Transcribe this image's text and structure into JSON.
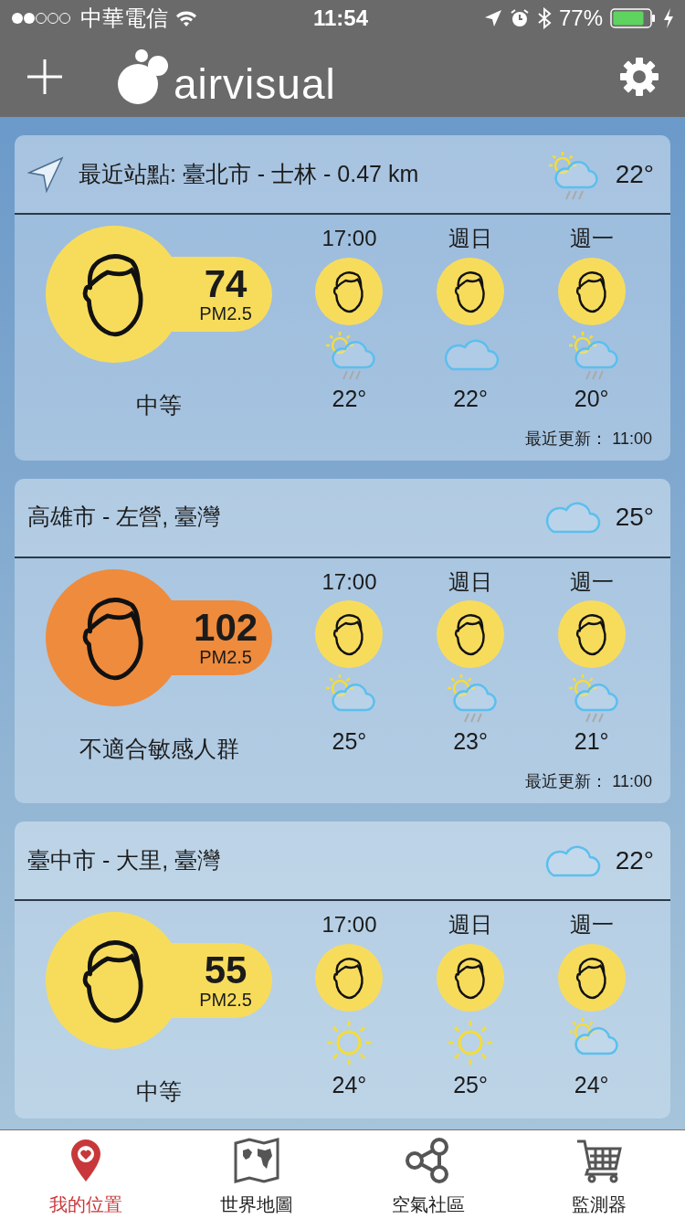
{
  "status_bar": {
    "carrier": "中華電信",
    "time": "11:54",
    "battery": "77%"
  },
  "nav": {
    "logo": "airvisual"
  },
  "cards": [
    {
      "title": "最近站點: 臺北市 - 士林 - 0.47 km",
      "nearest": true,
      "weather": {
        "kind": "sun-cloud-rain"
      },
      "temp": "22°",
      "aqi": "74",
      "unit": "PM2.5",
      "color": "#f7dc5c",
      "label": "中等",
      "updated": "最近更新： 11:00",
      "forecast": [
        {
          "time": "17:00",
          "color": "#f7dc5c",
          "weather": {
            "kind": "sun-cloud-rain"
          },
          "temp": "22°"
        },
        {
          "time": "週日",
          "color": "#f7dc5c",
          "weather": {
            "kind": "cloud"
          },
          "temp": "22°"
        },
        {
          "time": "週一",
          "color": "#f7dc5c",
          "weather": {
            "kind": "sun-cloud-rain"
          },
          "temp": "20°"
        }
      ]
    },
    {
      "title": "高雄市 - 左營, 臺灣",
      "nearest": false,
      "weather": {
        "kind": "cloud"
      },
      "temp": "25°",
      "aqi": "102",
      "unit": "PM2.5",
      "color": "#ef8b3c",
      "label": "不適合敏感人群",
      "updated": "最近更新： 11:00",
      "forecast": [
        {
          "time": "17:00",
          "color": "#f7dc5c",
          "weather": {
            "kind": "sun-cloud"
          },
          "temp": "25°"
        },
        {
          "time": "週日",
          "color": "#f7dc5c",
          "weather": {
            "kind": "sun-cloud-rain"
          },
          "temp": "23°"
        },
        {
          "time": "週一",
          "color": "#f7dc5c",
          "weather": {
            "kind": "sun-cloud-rain"
          },
          "temp": "21°"
        }
      ]
    },
    {
      "title": "臺中市 - 大里, 臺灣",
      "nearest": false,
      "weather": {
        "kind": "cloud"
      },
      "temp": "22°",
      "aqi": "55",
      "unit": "PM2.5",
      "color": "#f7dc5c",
      "label": "中等",
      "forecast": [
        {
          "time": "17:00",
          "color": "#f7dc5c",
          "weather": {
            "kind": "sun"
          },
          "temp": "24°"
        },
        {
          "time": "週日",
          "color": "#f7dc5c",
          "weather": {
            "kind": "sun"
          },
          "temp": "25°"
        },
        {
          "time": "週一",
          "color": "#f7dc5c",
          "weather": {
            "kind": "sun-cloud"
          },
          "temp": "24°"
        }
      ]
    }
  ],
  "tabs": [
    {
      "label": "我的位置",
      "kind": "location",
      "selected": true
    },
    {
      "label": "世界地圖",
      "kind": "map",
      "selected": false
    },
    {
      "label": "空氣社區",
      "kind": "community",
      "selected": false
    },
    {
      "label": "監測器",
      "kind": "monitor",
      "selected": false
    }
  ]
}
